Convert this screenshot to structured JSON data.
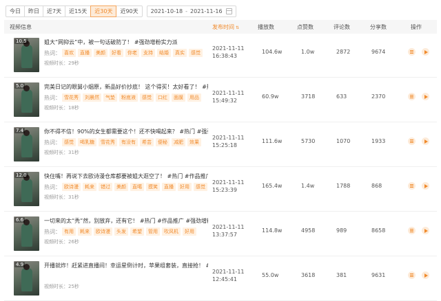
{
  "filters": {
    "ranges": [
      "今日",
      "昨日",
      "近7天",
      "近15天",
      "近30天",
      "近90天"
    ],
    "active_range": "近30天",
    "date_start": "2021-10-18",
    "date_sep": "-",
    "date_end": "2021-11-16",
    "calendar_icon": "calendar-icon"
  },
  "table": {
    "headers": {
      "video": "视频信息",
      "publish_time": "发布时间",
      "sort_symbol": "⇅",
      "plays": "播放数",
      "likes": "点赞数",
      "comments": "评论数",
      "shares": "分享数",
      "action": "操作"
    },
    "tag_label": "热词：",
    "duration_prefix": "视频时长：",
    "rows": [
      {
        "score": "10.5",
        "title": "姐大“网抑云”中，被一句话破防了！ #强劲增粉实力派",
        "tags": [
          "喜欢",
          "直播",
          "美颜",
          "好看",
          "你老",
          "支持",
          "结婚",
          "真实",
          "感觉"
        ],
        "duration": "29秒",
        "date": "2021-11-11",
        "time": "16:38:43",
        "plays": "104.6w",
        "likes": "1.0w",
        "comments": "2872",
        "shares": "9674"
      },
      {
        "score": "5.0",
        "title": "完美日记的眼舅小烟原，新品好价抄底！ 这个得买！太好看了！ #热门 …",
        "tags": [
          "雪花秀",
          "刘晨然",
          "气垫",
          "粉底液",
          "感觉",
          "口红",
          "面膜",
          "用品"
        ],
        "duration": "18秒",
        "date": "2021-11-11",
        "time": "15:49:32",
        "plays": "60.9w",
        "likes": "3718",
        "comments": "633",
        "shares": "2370"
      },
      {
        "score": "7.4",
        "title": "你不得不信！90%的女生都需要这个！还不快喝起来？ #热门 #强劲增…",
        "tags": [
          "感觉",
          "喝乳糖",
          "雪花秀",
          "有没有",
          "希芸",
          "便秘",
          "减肥",
          "效果"
        ],
        "duration": "31秒",
        "date": "2021-11-11",
        "time": "15:25:18",
        "plays": "111.6w",
        "likes": "5730",
        "comments": "1070",
        "shares": "1933"
      },
      {
        "score": "12.0",
        "title": "快住嘴！再说下去欧诗漫仓库都要被姐大逛空了！ #热门 #作品推广 #…",
        "tags": [
          "欧诗漫",
          "耗来",
          "错过",
          "美颜",
          "直噶",
          "摸笑",
          "直播",
          "好用",
          "感觉"
        ],
        "duration": "31秒",
        "date": "2021-11-11",
        "time": "15:23:39",
        "plays": "165.4w",
        "likes": "1.4w",
        "comments": "1788",
        "shares": "868"
      },
      {
        "score": "6.6",
        "title": "一切来的太“秃”然，别放弃，还有它！ #热门 #作品推广 #强劲增粉…",
        "tags": [
          "有用",
          "耗来",
          "欧诗漫",
          "头发",
          "希望",
          "管用",
          "吹风机",
          "好用"
        ],
        "duration": "26秒",
        "date": "2021-11-11",
        "time": "13:37:57",
        "plays": "114.8w",
        "likes": "4958",
        "comments": "989",
        "shares": "8658"
      },
      {
        "score": "4.9",
        "title": "开播就炸！赶紧进直播间！幸运星倒计时，苹果组套装，直接抢！ #强…",
        "tags": [],
        "duration": "25秒",
        "date": "2021-11-11",
        "time": "12:45:41",
        "plays": "55.0w",
        "likes": "3618",
        "comments": "381",
        "shares": "9631"
      }
    ]
  },
  "colors": {
    "accent": "#f08a2b",
    "tag_bg": "#fff1e2",
    "header_bg": "#f6f6f6"
  },
  "icons": {
    "detail": "list-icon",
    "play": "play-icon"
  }
}
